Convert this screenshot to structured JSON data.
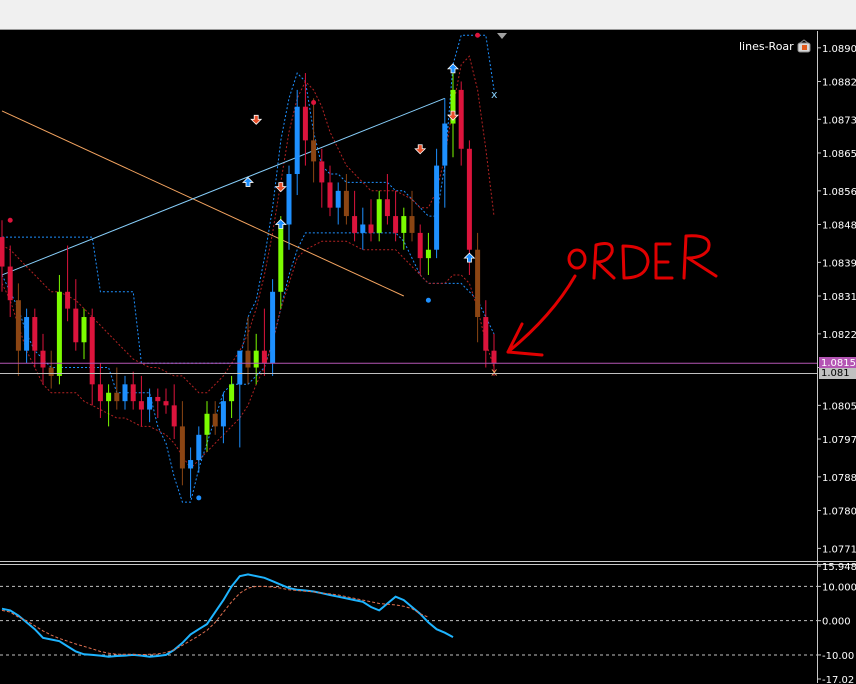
{
  "window": {
    "indicator_name": "lines-Roar"
  },
  "annotation": {
    "text": "ORDER",
    "color": "#e00000"
  },
  "current_price": {
    "bid": "1.0815",
    "ask": "1.081",
    "bid_color": "#b455b4",
    "ask_color": "#c0c0c0"
  },
  "colors": {
    "bull": "#1e90ff",
    "bull_alt": "#7cfc00",
    "bear": "#dc143c",
    "bear_alt": "#8b4513",
    "band_outer": "#1e90ff",
    "band_inner": "#b22222",
    "trendline_up": "#87cefa",
    "trendline_down": "#f4a460",
    "osc_main": "#1eb4ff",
    "osc_signal": "#e07050",
    "grid_zero": "#c0c0c0"
  },
  "chart_data": [
    {
      "type": "candlestick",
      "y_axis": {
        "ylim": [
          1.0768,
          1.0894
        ],
        "ticks": [
          "1.0890",
          "1.0882",
          "1.0873",
          "1.0865",
          "1.0856",
          "1.0848",
          "1.0839",
          "1.0831",
          "1.0822",
          "1.0814",
          "1.0805",
          "1.0797",
          "1.0788",
          "1.0780",
          "1.0771"
        ],
        "tick_values": [
          1.089,
          1.0882,
          1.0873,
          1.0865,
          1.0856,
          1.0848,
          1.0839,
          1.0831,
          1.0822,
          1.0814,
          1.0805,
          1.0797,
          1.0788,
          1.078,
          1.0771
        ]
      },
      "candles": [
        [
          1.0845,
          1.0849,
          1.0832,
          1.0838
        ],
        [
          1.0838,
          1.0843,
          1.0826,
          1.083
        ],
        [
          1.083,
          1.0834,
          1.0812,
          1.0818
        ],
        [
          1.0818,
          1.0828,
          1.0815,
          1.0826
        ],
        [
          1.0826,
          1.0828,
          1.0814,
          1.0818
        ],
        [
          1.0818,
          1.0822,
          1.081,
          1.0814
        ],
        [
          1.0814,
          1.0818,
          1.0809,
          1.0812
        ],
        [
          1.0812,
          1.0836,
          1.081,
          1.0832
        ],
        [
          1.0832,
          1.0843,
          1.0825,
          1.0828
        ],
        [
          1.0828,
          1.0835,
          1.0818,
          1.082
        ],
        [
          1.082,
          1.0828,
          1.0816,
          1.0826
        ],
        [
          1.0826,
          1.0828,
          1.0805,
          1.081
        ],
        [
          1.081,
          1.0815,
          1.0802,
          1.0806
        ],
        [
          1.0806,
          1.081,
          1.08,
          1.0808
        ],
        [
          1.0808,
          1.0814,
          1.0804,
          1.0806
        ],
        [
          1.0806,
          1.0812,
          1.0804,
          1.081
        ],
        [
          1.081,
          1.0813,
          1.0804,
          1.0806
        ],
        [
          1.0806,
          1.0812,
          1.08,
          1.0804
        ],
        [
          1.0804,
          1.0809,
          1.0801,
          1.0807
        ],
        [
          1.0807,
          1.0809,
          1.0802,
          1.0806
        ],
        [
          1.0806,
          1.0809,
          1.0803,
          1.0805
        ],
        [
          1.0805,
          1.081,
          1.0797,
          1.08
        ],
        [
          1.08,
          1.0806,
          1.0786,
          1.079
        ],
        [
          1.079,
          1.0795,
          1.0783,
          1.0792
        ],
        [
          1.0792,
          1.08,
          1.0789,
          1.0798
        ],
        [
          1.0798,
          1.0806,
          1.0794,
          1.0803
        ],
        [
          1.0803,
          1.0806,
          1.0798,
          1.08
        ],
        [
          1.08,
          1.0808,
          1.0796,
          1.0806
        ],
        [
          1.0806,
          1.0812,
          1.0802,
          1.081
        ],
        [
          1.081,
          1.0816,
          1.0795,
          1.0818
        ],
        [
          1.0818,
          1.0826,
          1.081,
          1.0814
        ],
        [
          1.0814,
          1.0822,
          1.081,
          1.0818
        ],
        [
          1.0818,
          1.0828,
          1.0812,
          1.0815
        ],
        [
          1.0815,
          1.0835,
          1.0812,
          1.0832
        ],
        [
          1.0832,
          1.085,
          1.0828,
          1.0848
        ],
        [
          1.0848,
          1.0862,
          1.0842,
          1.086
        ],
        [
          1.086,
          1.088,
          1.0855,
          1.0876
        ],
        [
          1.0876,
          1.0884,
          1.0862,
          1.0868
        ],
        [
          1.0868,
          1.0878,
          1.0858,
          1.0863
        ],
        [
          1.0863,
          1.0866,
          1.0852,
          1.0858
        ],
        [
          1.0858,
          1.0862,
          1.085,
          1.0852
        ],
        [
          1.0852,
          1.0858,
          1.0848,
          1.0856
        ],
        [
          1.0856,
          1.086,
          1.0848,
          1.085
        ],
        [
          1.085,
          1.0856,
          1.0844,
          1.0846
        ],
        [
          1.0846,
          1.0852,
          1.0842,
          1.0848
        ],
        [
          1.0848,
          1.0854,
          1.0844,
          1.0846
        ],
        [
          1.0846,
          1.0856,
          1.0844,
          1.0854
        ],
        [
          1.0854,
          1.086,
          1.0848,
          1.085
        ],
        [
          1.085,
          1.0856,
          1.0844,
          1.0846
        ],
        [
          1.0846,
          1.0852,
          1.0842,
          1.085
        ],
        [
          1.085,
          1.0856,
          1.0844,
          1.0846
        ],
        [
          1.0846,
          1.0848,
          1.0836,
          1.084
        ],
        [
          1.084,
          1.0846,
          1.0836,
          1.0842
        ],
        [
          1.0842,
          1.0866,
          1.084,
          1.0862
        ],
        [
          1.0862,
          1.0878,
          1.0852,
          1.0872
        ],
        [
          1.0872,
          1.0886,
          1.0864,
          1.088
        ],
        [
          1.088,
          1.0882,
          1.0862,
          1.0866
        ],
        [
          1.0866,
          1.0868,
          1.0836,
          1.0842
        ],
        [
          1.0842,
          1.0846,
          1.082,
          1.0826
        ],
        [
          1.0826,
          1.083,
          1.0814,
          1.0818
        ],
        [
          1.0818,
          1.0822,
          1.0812,
          1.0815
        ]
      ],
      "upper_band_outer": [
        1.0845,
        1.0845,
        1.0845,
        1.0845,
        1.0845,
        1.0845,
        1.0845,
        1.0845,
        1.0845,
        1.0845,
        1.0845,
        1.0845,
        1.0832,
        1.0832,
        1.0832,
        1.0832,
        1.0832,
        1.0815,
        1.0815,
        1.0815,
        1.0815,
        1.0815,
        1.0815,
        1.0815,
        1.0815,
        1.0815,
        1.0815,
        1.0815,
        1.0815,
        1.0815,
        1.0826,
        1.083,
        1.084,
        1.0852,
        1.0868,
        1.0878,
        1.0884,
        1.0882,
        1.087,
        1.0862,
        1.086,
        1.086,
        1.0858,
        1.0858,
        1.0858,
        1.0858,
        1.0858,
        1.0858,
        1.0856,
        1.0856,
        1.0854,
        1.0852,
        1.085,
        1.085,
        1.0862,
        1.0886,
        1.0893,
        1.0893,
        1.0893,
        1.0893,
        1.088
      ],
      "lower_band_outer": [
        1.0836,
        1.0832,
        1.0828,
        1.0822,
        1.0818,
        1.0816,
        1.0814,
        1.0814,
        1.0814,
        1.0814,
        1.0814,
        1.0814,
        1.0814,
        1.0814,
        1.0808,
        1.0808,
        1.0808,
        1.0808,
        1.0808,
        1.08,
        1.0796,
        1.0788,
        1.0782,
        1.0782,
        1.079,
        1.0796,
        1.0802,
        1.0808,
        1.081,
        1.081,
        1.081,
        1.0812,
        1.0814,
        1.082,
        1.0828,
        1.0836,
        1.0842,
        1.0846,
        1.0846,
        1.0846,
        1.0846,
        1.0846,
        1.0846,
        1.0846,
        1.0846,
        1.0846,
        1.0846,
        1.0846,
        1.0846,
        1.0844,
        1.084,
        1.0836,
        1.0834,
        1.0834,
        1.0834,
        1.0834,
        1.0834,
        1.0832,
        1.083,
        1.0826,
        1.0822
      ],
      "upper_band_inner": [
        1.0843,
        1.0842,
        1.084,
        1.0838,
        1.0836,
        1.0834,
        1.0832,
        1.0832,
        1.0831,
        1.083,
        1.0828,
        1.0826,
        1.0824,
        1.0822,
        1.082,
        1.0818,
        1.0816,
        1.0815,
        1.0814,
        1.0814,
        1.0813,
        1.0812,
        1.0812,
        1.081,
        1.0808,
        1.0808,
        1.081,
        1.0812,
        1.0815,
        1.0818,
        1.0822,
        1.0828,
        1.0836,
        1.0846,
        1.0858,
        1.087,
        1.0878,
        1.0882,
        1.088,
        1.0876,
        1.087,
        1.0866,
        1.0862,
        1.086,
        1.0858,
        1.0856,
        1.0856,
        1.0856,
        1.0856,
        1.0855,
        1.0854,
        1.0852,
        1.0852,
        1.0856,
        1.0864,
        1.0876,
        1.0886,
        1.0888,
        1.088,
        1.0866,
        1.085
      ],
      "lower_band_inner": [
        1.0834,
        1.083,
        1.0824,
        1.0818,
        1.0814,
        1.081,
        1.0808,
        1.0808,
        1.0808,
        1.0808,
        1.0806,
        1.0805,
        1.0804,
        1.0803,
        1.0802,
        1.0802,
        1.0801,
        1.08,
        1.08,
        1.0799,
        1.0798,
        1.0796,
        1.0793,
        1.079,
        1.0792,
        1.0794,
        1.0796,
        1.0798,
        1.08,
        1.0802,
        1.0805,
        1.081,
        1.0814,
        1.082,
        1.0828,
        1.0834,
        1.084,
        1.0842,
        1.0843,
        1.0844,
        1.0844,
        1.0844,
        1.0844,
        1.0843,
        1.0842,
        1.0842,
        1.0842,
        1.0842,
        1.0842,
        1.084,
        1.0838,
        1.0836,
        1.0834,
        1.0834,
        1.0834,
        1.0836,
        1.0836,
        1.0834,
        1.0828,
        1.082,
        1.0814
      ],
      "trendlines": [
        {
          "from": [
            0,
            1.0875
          ],
          "to": [
            49,
            1.0831
          ],
          "color_key": "trendline_down"
        },
        {
          "from": [
            0,
            1.0836
          ],
          "to": [
            54,
            1.0878
          ],
          "color_key": "trendline_up"
        }
      ],
      "signals": [
        {
          "i": 30,
          "type": "buy",
          "y": 1.0858
        },
        {
          "i": 31,
          "type": "sell",
          "y": 1.0873
        },
        {
          "i": 34,
          "type": "sell",
          "y": 1.0857
        },
        {
          "i": 34,
          "type": "buy",
          "y": 1.0848
        },
        {
          "i": 51,
          "type": "sell",
          "y": 1.0866
        },
        {
          "i": 55,
          "type": "buy",
          "y": 1.0885
        },
        {
          "i": 55,
          "type": "sell",
          "y": 1.0874
        },
        {
          "i": 57,
          "type": "buy",
          "y": 1.084
        }
      ],
      "dots": [
        {
          "i": 1,
          "y": 1.0849,
          "color_key": "bear"
        },
        {
          "i": 24,
          "y": 1.0783,
          "color_key": "bull"
        },
        {
          "i": 38,
          "y": 1.0877,
          "color_key": "bear"
        },
        {
          "i": 52,
          "y": 1.083,
          "color_key": "bull"
        },
        {
          "i": 58,
          "y": 1.0893,
          "color_key": "bear"
        }
      ],
      "bid": 1.0815,
      "ask": 1.0814
    },
    {
      "type": "line",
      "y_axis": {
        "ylim": [
          -17.02,
          15.948
        ],
        "ticks": [
          "15.948",
          "10.000",
          "0.000",
          "-10.00",
          "-17.02"
        ],
        "tick_values": [
          15.948,
          10.0,
          0.0,
          -10.0,
          -17.02
        ],
        "levels": [
          10.0,
          0.0,
          -10.0
        ]
      },
      "series": [
        {
          "color_key": "osc_main",
          "values": [
            3.5,
            3.0,
            1.5,
            -0.5,
            -2.5,
            -5.0,
            -5.5,
            -6.0,
            -7.5,
            -9.0,
            -9.8,
            -10.0,
            -10.2,
            -10.5,
            -10.3,
            -10.2,
            -10.0,
            -10.2,
            -10.5,
            -10.3,
            -10.0,
            -8.5,
            -6.5,
            -4.0,
            -2.5,
            -1.0,
            2.5,
            6.0,
            10.0,
            13.0,
            13.5,
            13.0,
            12.5,
            11.5,
            10.5,
            9.5,
            9.0,
            8.8,
            8.5,
            8.0,
            7.5,
            7.0,
            6.5,
            6.0,
            5.5,
            4.0,
            3.0,
            5.0,
            7.0,
            6.0,
            4.0,
            2.0,
            -0.5,
            -2.5,
            -3.5,
            -4.8
          ]
        },
        {
          "color_key": "osc_signal",
          "values": [
            3.0,
            2.5,
            1.0,
            0.0,
            -1.5,
            -3.0,
            -4.2,
            -5.2,
            -6.0,
            -6.8,
            -7.5,
            -8.2,
            -9.0,
            -9.5,
            -9.8,
            -9.8,
            -9.8,
            -9.9,
            -9.8,
            -9.7,
            -9.3,
            -8.5,
            -7.2,
            -5.8,
            -4.4,
            -2.8,
            -0.5,
            2.5,
            5.5,
            8.0,
            9.5,
            10.0,
            10.0,
            9.8,
            9.5,
            9.0,
            8.8,
            8.6,
            8.4,
            8.0,
            7.8,
            7.5,
            7.0,
            6.5,
            6.0,
            5.5,
            5.0,
            4.8,
            4.6,
            4.2,
            3.5,
            2.0,
            1.0
          ]
        }
      ]
    }
  ]
}
